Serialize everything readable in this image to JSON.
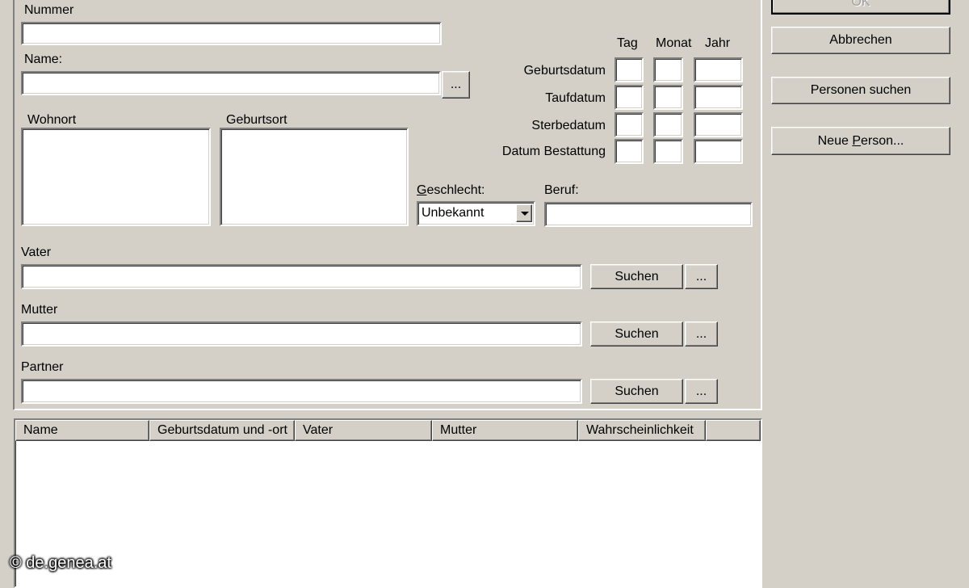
{
  "buttons": {
    "ok": "OK",
    "cancel": "Abbrechen",
    "search_persons": "Personen suchen",
    "new_person_pre": "Neue ",
    "new_person_key": "P",
    "new_person_post": "erson...",
    "ellipsis": "...",
    "search": "Suchen"
  },
  "form": {
    "number_label": "Nummer",
    "number_value": "",
    "name_label": "Name:",
    "name_value": "",
    "residence_label": "Wohnort",
    "birthplace_label": "Geburtsort",
    "date_headers": {
      "day": "Tag",
      "month": "Monat",
      "year": "Jahr"
    },
    "date_rows": [
      "Geburtsdatum",
      "Taufdatum",
      "Sterbedatum",
      "Datum Bestattung"
    ],
    "gender_label_key": "G",
    "gender_label_rest": "eschlecht:",
    "gender_value": "Unbekannt",
    "occupation_label": "Beruf:",
    "occupation_value": "",
    "father_label": "Vater",
    "mother_label": "Mutter",
    "partner_label": "Partner"
  },
  "results": {
    "columns": [
      "Name",
      "Geburtsdatum und -ort",
      "Vater",
      "Mutter",
      "Wahrscheinlichkeit"
    ],
    "rows": []
  },
  "watermark": "© de.genea.at"
}
